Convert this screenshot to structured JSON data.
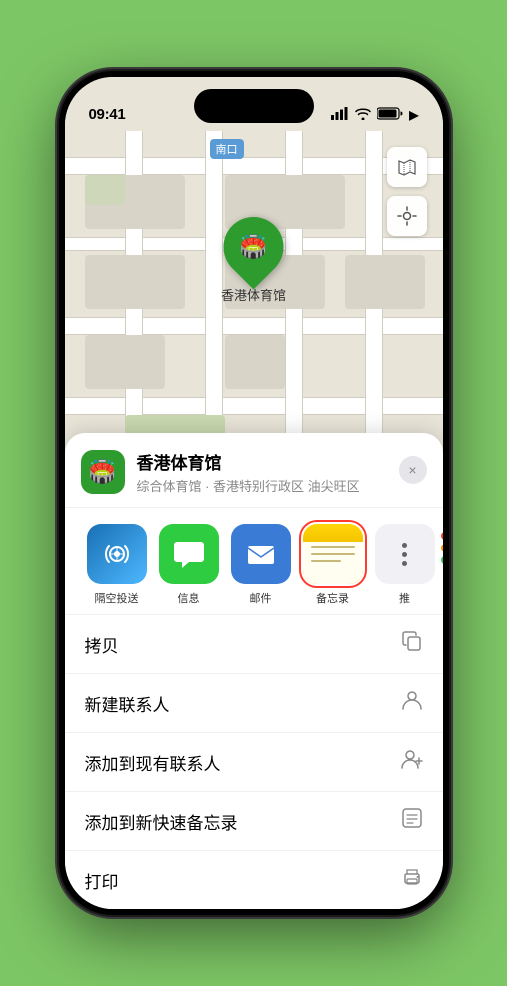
{
  "status_bar": {
    "time": "09:41",
    "signal_icon": "▌▌▌▌",
    "wifi_icon": "wifi",
    "battery_icon": "battery"
  },
  "map": {
    "label": "南口",
    "location_name": "香港体育馆",
    "controls": {
      "map_type_icon": "map",
      "location_icon": "location"
    }
  },
  "sheet": {
    "title": "香港体育馆",
    "subtitle": "综合体育馆 · 香港特别行政区 油尖旺区",
    "close_label": "×",
    "share_apps": [
      {
        "name": "隔空投送",
        "type": "airdrop"
      },
      {
        "name": "信息",
        "type": "message"
      },
      {
        "name": "邮件",
        "type": "mail"
      },
      {
        "name": "备忘录",
        "type": "notes",
        "selected": true
      },
      {
        "name": "推",
        "type": "more"
      }
    ],
    "actions": [
      {
        "label": "拷贝",
        "icon": "copy"
      },
      {
        "label": "新建联系人",
        "icon": "person"
      },
      {
        "label": "添加到现有联系人",
        "icon": "person-add"
      },
      {
        "label": "添加到新快速备忘录",
        "icon": "note"
      },
      {
        "label": "打印",
        "icon": "printer"
      }
    ]
  }
}
